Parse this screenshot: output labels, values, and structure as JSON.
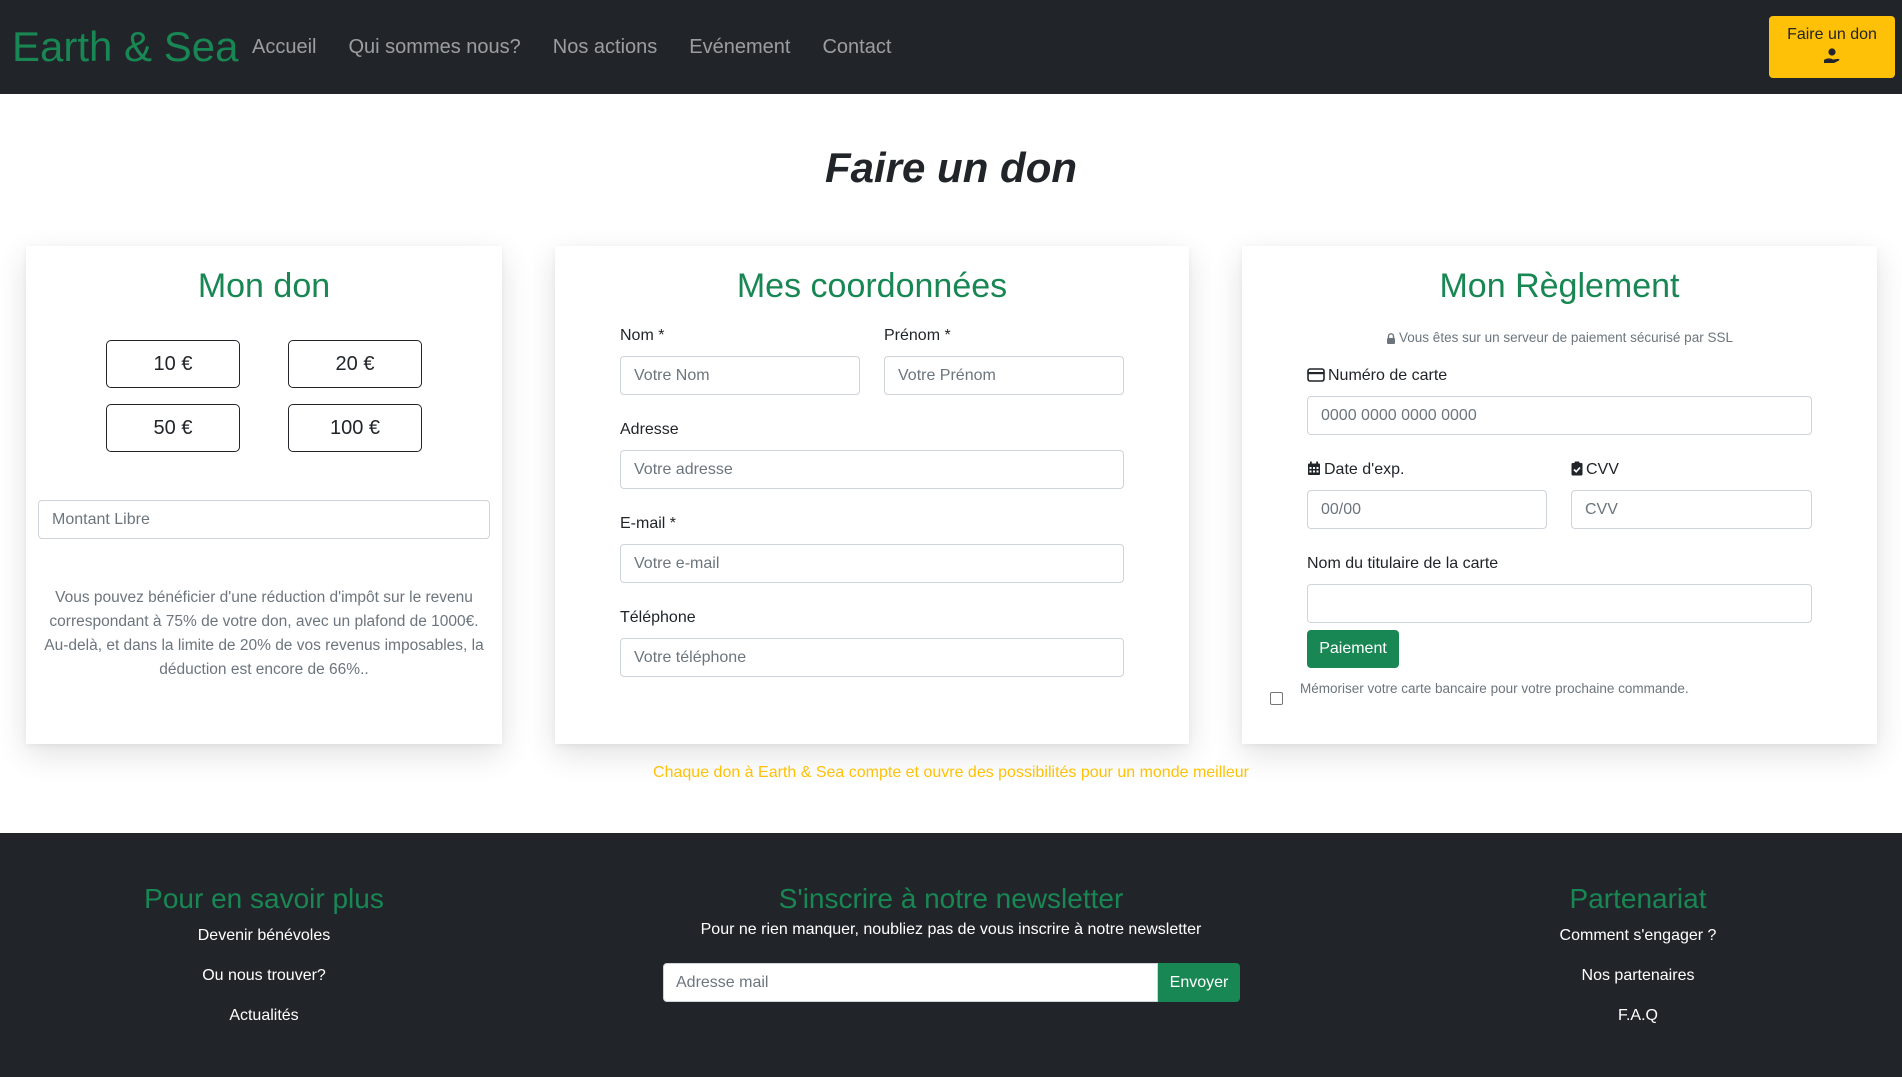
{
  "nav": {
    "brand": "Earth & Sea",
    "links": [
      "Accueil",
      "Qui sommes nous?",
      "Nos actions",
      "Evénement",
      "Contact"
    ],
    "donate_label": "Faire un don"
  },
  "page": {
    "title": "Faire un don"
  },
  "don": {
    "title": "Mon don",
    "amounts": [
      "10 €",
      "20 €",
      "50 €",
      "100 €"
    ],
    "free_placeholder": "Montant Libre",
    "info": "Vous pouvez bénéficier d'une réduction d'impôt sur le revenu correspondant à 75% de votre don, avec un plafond de 1000€. Au-delà, et dans la limite de 20% de vos revenus imposables, la déduction est encore de 66%.."
  },
  "coord": {
    "title": "Mes coordonnées",
    "nom_label": "Nom *",
    "nom_placeholder": "Votre Nom",
    "prenom_label": "Prénom *",
    "prenom_placeholder": "Votre Prénom",
    "adresse_label": "Adresse",
    "adresse_placeholder": "Votre adresse",
    "email_label": "E-mail *",
    "email_placeholder": "Votre e-mail",
    "tel_label": "Téléphone",
    "tel_placeholder": "Votre téléphone"
  },
  "reglement": {
    "title": "Mon Règlement",
    "ssl_note": "Vous êtes sur un serveur de paiement sécurisé par SSL",
    "card_number_label": "Numéro de carte",
    "card_number_placeholder": "0000 0000 0000 0000",
    "exp_label": "Date d'exp.",
    "exp_placeholder": "00/00",
    "cvv_label": "CVV",
    "cvv_placeholder": "CVV",
    "holder_label": "Nom du titulaire de la carte",
    "holder_value": "",
    "pay_label": "Paiement",
    "remember_label": "Mémoriser votre carte bancaire pour votre prochaine commande."
  },
  "tagline": "Chaque don à Earth & Sea compte et ouvre des possibilités pour un monde meilleur",
  "footer": {
    "col1": {
      "title": "Pour en savoir plus",
      "links": [
        "Devenir bénévoles",
        "Ou nous trouver?",
        "Actualités"
      ]
    },
    "newsletter": {
      "title": "S'inscrire à notre newsletter",
      "text": "Pour ne rien manquer, noubliez pas de vous inscrire à notre newsletter",
      "placeholder": "Adresse mail",
      "button": "Envoyer"
    },
    "col3": {
      "title": "Partenariat",
      "links": [
        "Comment s'engager ?",
        "Nos partenaires",
        "F.A.Q"
      ]
    }
  },
  "colors": {
    "dark": "#212529",
    "green": "#198754",
    "yellow": "#ffc107",
    "muted": "#6c757d"
  }
}
